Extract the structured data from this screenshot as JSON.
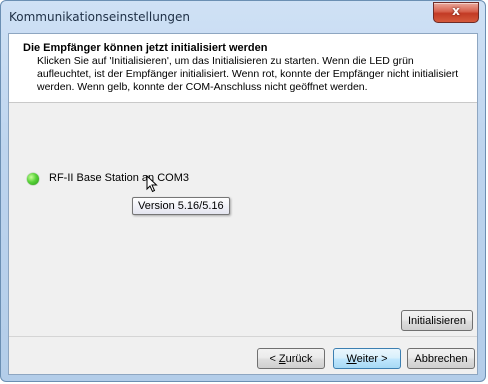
{
  "window": {
    "title": "Kommunikationseinstellungen",
    "close_glyph": "x"
  },
  "header": {
    "title": "Die Empfänger können jetzt initialisiert werden",
    "description": "Klicken Sie auf 'Initialisieren', um das Initialisieren zu starten. Wenn die LED grün aufleuchtet, ist der Empfänger initialisiert. Wenn rot, konnte der Empfänger nicht initialisiert werden. Wenn gelb, konnte der COM-Anschluss nicht geöffnet werden."
  },
  "device": {
    "label": "RF-II Base Station an COM3",
    "led_status": "green",
    "led_color": "#4cc22c",
    "tooltip": "Version 5.16/5.16"
  },
  "buttons": {
    "initialize": "Initialisieren",
    "back_prefix": "< ",
    "back_underlined": "Z",
    "back_rest": "urück",
    "next_underlined": "W",
    "next_rest": "eiter >",
    "cancel": "Abbrechen"
  }
}
